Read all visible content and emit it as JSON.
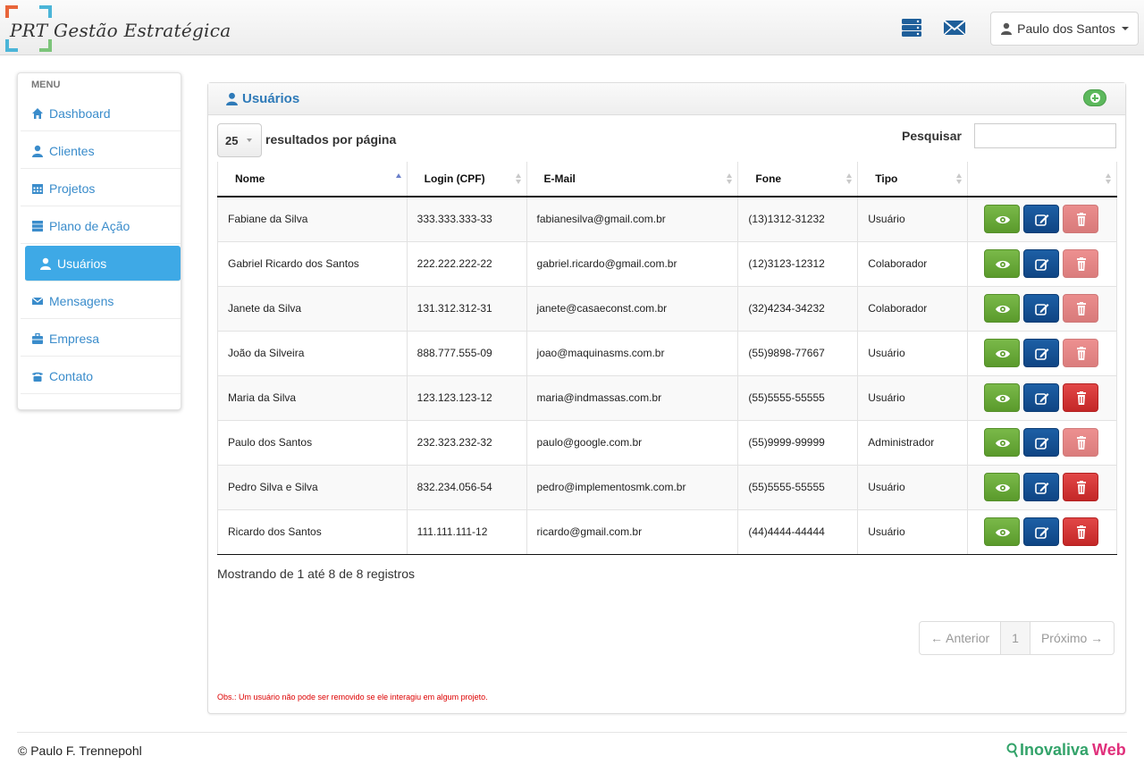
{
  "app": {
    "brand": "PRT Gestão Estratégica",
    "user_name": "Paulo dos Santos"
  },
  "sidebar": {
    "heading": "MENU",
    "items": [
      {
        "label": "Dashboard",
        "icon": "home-icon"
      },
      {
        "label": "Clientes",
        "icon": "user-icon"
      },
      {
        "label": "Projetos",
        "icon": "calendar-icon"
      },
      {
        "label": "Plano de Ação",
        "icon": "server-icon"
      },
      {
        "label": "Usuários",
        "icon": "user-icon",
        "active": true
      },
      {
        "label": "Mensagens",
        "icon": "envelope-icon"
      },
      {
        "label": "Empresa",
        "icon": "briefcase-icon"
      },
      {
        "label": "Contato",
        "icon": "phone-icon"
      }
    ]
  },
  "panel": {
    "title": "Usuários",
    "page_length": "25",
    "page_length_label": "resultados por página",
    "search_label": "Pesquisar",
    "search_value": ""
  },
  "table": {
    "columns": [
      "Nome",
      "Login (CPF)",
      "E-Mail",
      "Fone",
      "Tipo",
      ""
    ],
    "rows": [
      {
        "nome": "Fabiane da Silva",
        "login": "333.333.333-33",
        "email": "fabianesilva@gmail.com.br",
        "fone": "(13)1312-31232",
        "tipo": "Usuário",
        "delete_enabled": false
      },
      {
        "nome": "Gabriel Ricardo dos Santos",
        "login": "222.222.222-22",
        "email": "gabriel.ricardo@gmail.com.br",
        "fone": "(12)3123-12312",
        "tipo": "Colaborador",
        "delete_enabled": false
      },
      {
        "nome": "Janete da Silva",
        "login": "131.312.312-31",
        "email": "janete@casaeconst.com.br",
        "fone": "(32)4234-34232",
        "tipo": "Colaborador",
        "delete_enabled": false
      },
      {
        "nome": "João da Silveira",
        "login": "888.777.555-09",
        "email": "joao@maquinasms.com.br",
        "fone": "(55)9898-77667",
        "tipo": "Usuário",
        "delete_enabled": false
      },
      {
        "nome": "Maria da Silva",
        "login": "123.123.123-12",
        "email": "maria@indmassas.com.br",
        "fone": "(55)5555-55555",
        "tipo": "Usuário",
        "delete_enabled": true
      },
      {
        "nome": "Paulo dos Santos",
        "login": "232.323.232-32",
        "email": "paulo@google.com.br",
        "fone": "(55)9999-99999",
        "tipo": "Administrador",
        "delete_enabled": false
      },
      {
        "nome": "Pedro Silva e Silva",
        "login": "832.234.056-54",
        "email": "pedro@implementosmk.com.br",
        "fone": "(55)5555-55555",
        "tipo": "Usuário",
        "delete_enabled": true
      },
      {
        "nome": "Ricardo dos Santos",
        "login": "111.111.111-12",
        "email": "ricardo@gmail.com.br",
        "fone": "(44)4444-44444",
        "tipo": "Usuário",
        "delete_enabled": true
      }
    ]
  },
  "info": "Mostrando de 1 até 8 de 8 registros",
  "pagination": {
    "prev": "← Anterior",
    "current": "1",
    "next": "Próximo →"
  },
  "note": "Obs.: Um usuário não pode ser removido se ele interagiu em algum projeto.",
  "footer": {
    "copyright": "© Paulo F. Trennepohl",
    "brand_a": "Inovaliva",
    "brand_b": "Web"
  },
  "colors": {
    "accent": "#3ea9e6",
    "link": "#3a8ccb",
    "view": "#6aab3b",
    "edit": "#174f93",
    "delete": "#d33434"
  }
}
